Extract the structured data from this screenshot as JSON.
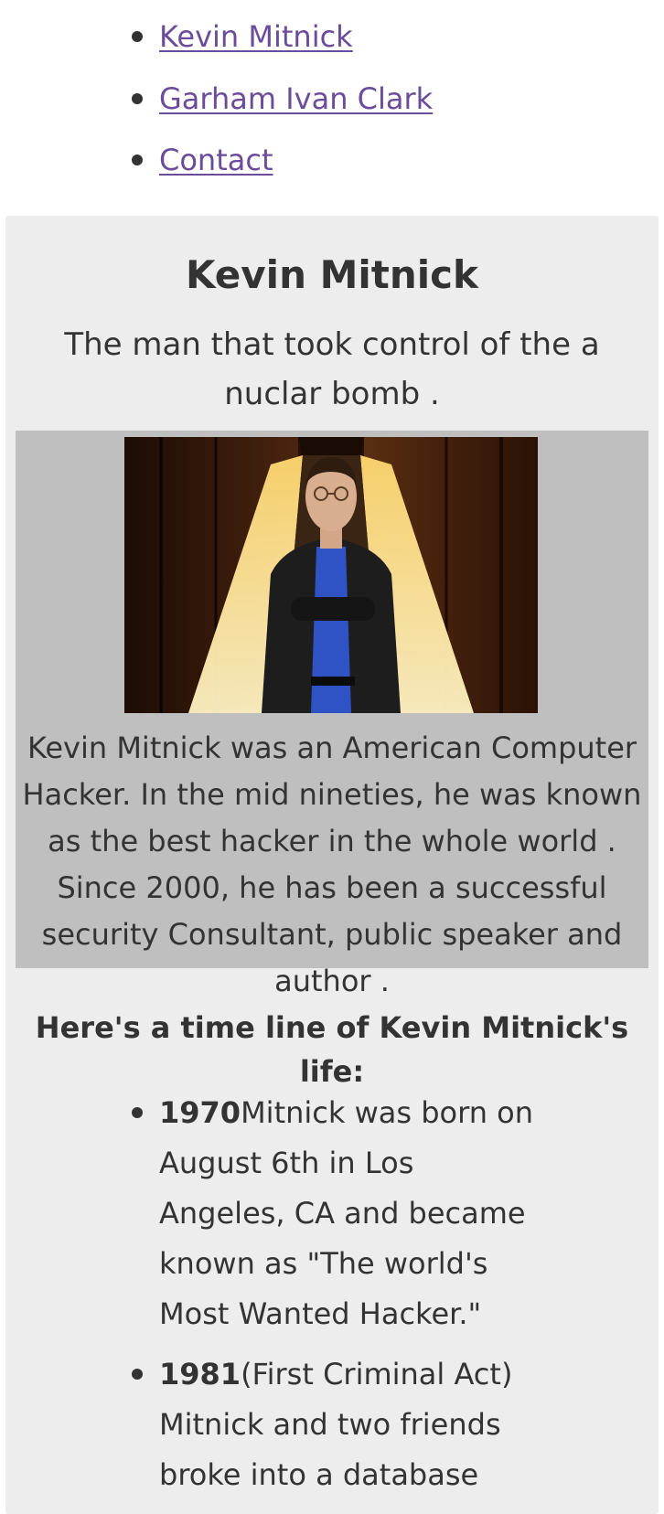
{
  "nav": {
    "items": [
      {
        "label": "Kevin Mitnick"
      },
      {
        "label": "Garham Ivan Clark"
      },
      {
        "label": "Contact"
      }
    ]
  },
  "main": {
    "title": "Kevin Mitnick",
    "subtitle": "The man that took control of the a nuclar bomb .",
    "figure": {
      "caption": "Kevin Mitnick was an American Computer Hacker. In the mid nineties, he was known as the best hacker in the whole world . Since 2000, he has been a successful security Consultant, public speaker and author ."
    },
    "timeline_heading": "Here's a time line of Kevin Mitnick's life:",
    "timeline": [
      {
        "year": "1970",
        "text": "Mitnick was born on August 6th in Los Angeles, CA and became known as \"The world's Most Wanted Hacker.\""
      },
      {
        "year": "1981",
        "text": "(First Criminal Act) Mitnick and two friends broke into a database"
      }
    ]
  },
  "colors": {
    "link": "#6b4c9a",
    "text": "#333333",
    "card_bg": "#ededed",
    "figure_bg": "#bfbfbf"
  }
}
